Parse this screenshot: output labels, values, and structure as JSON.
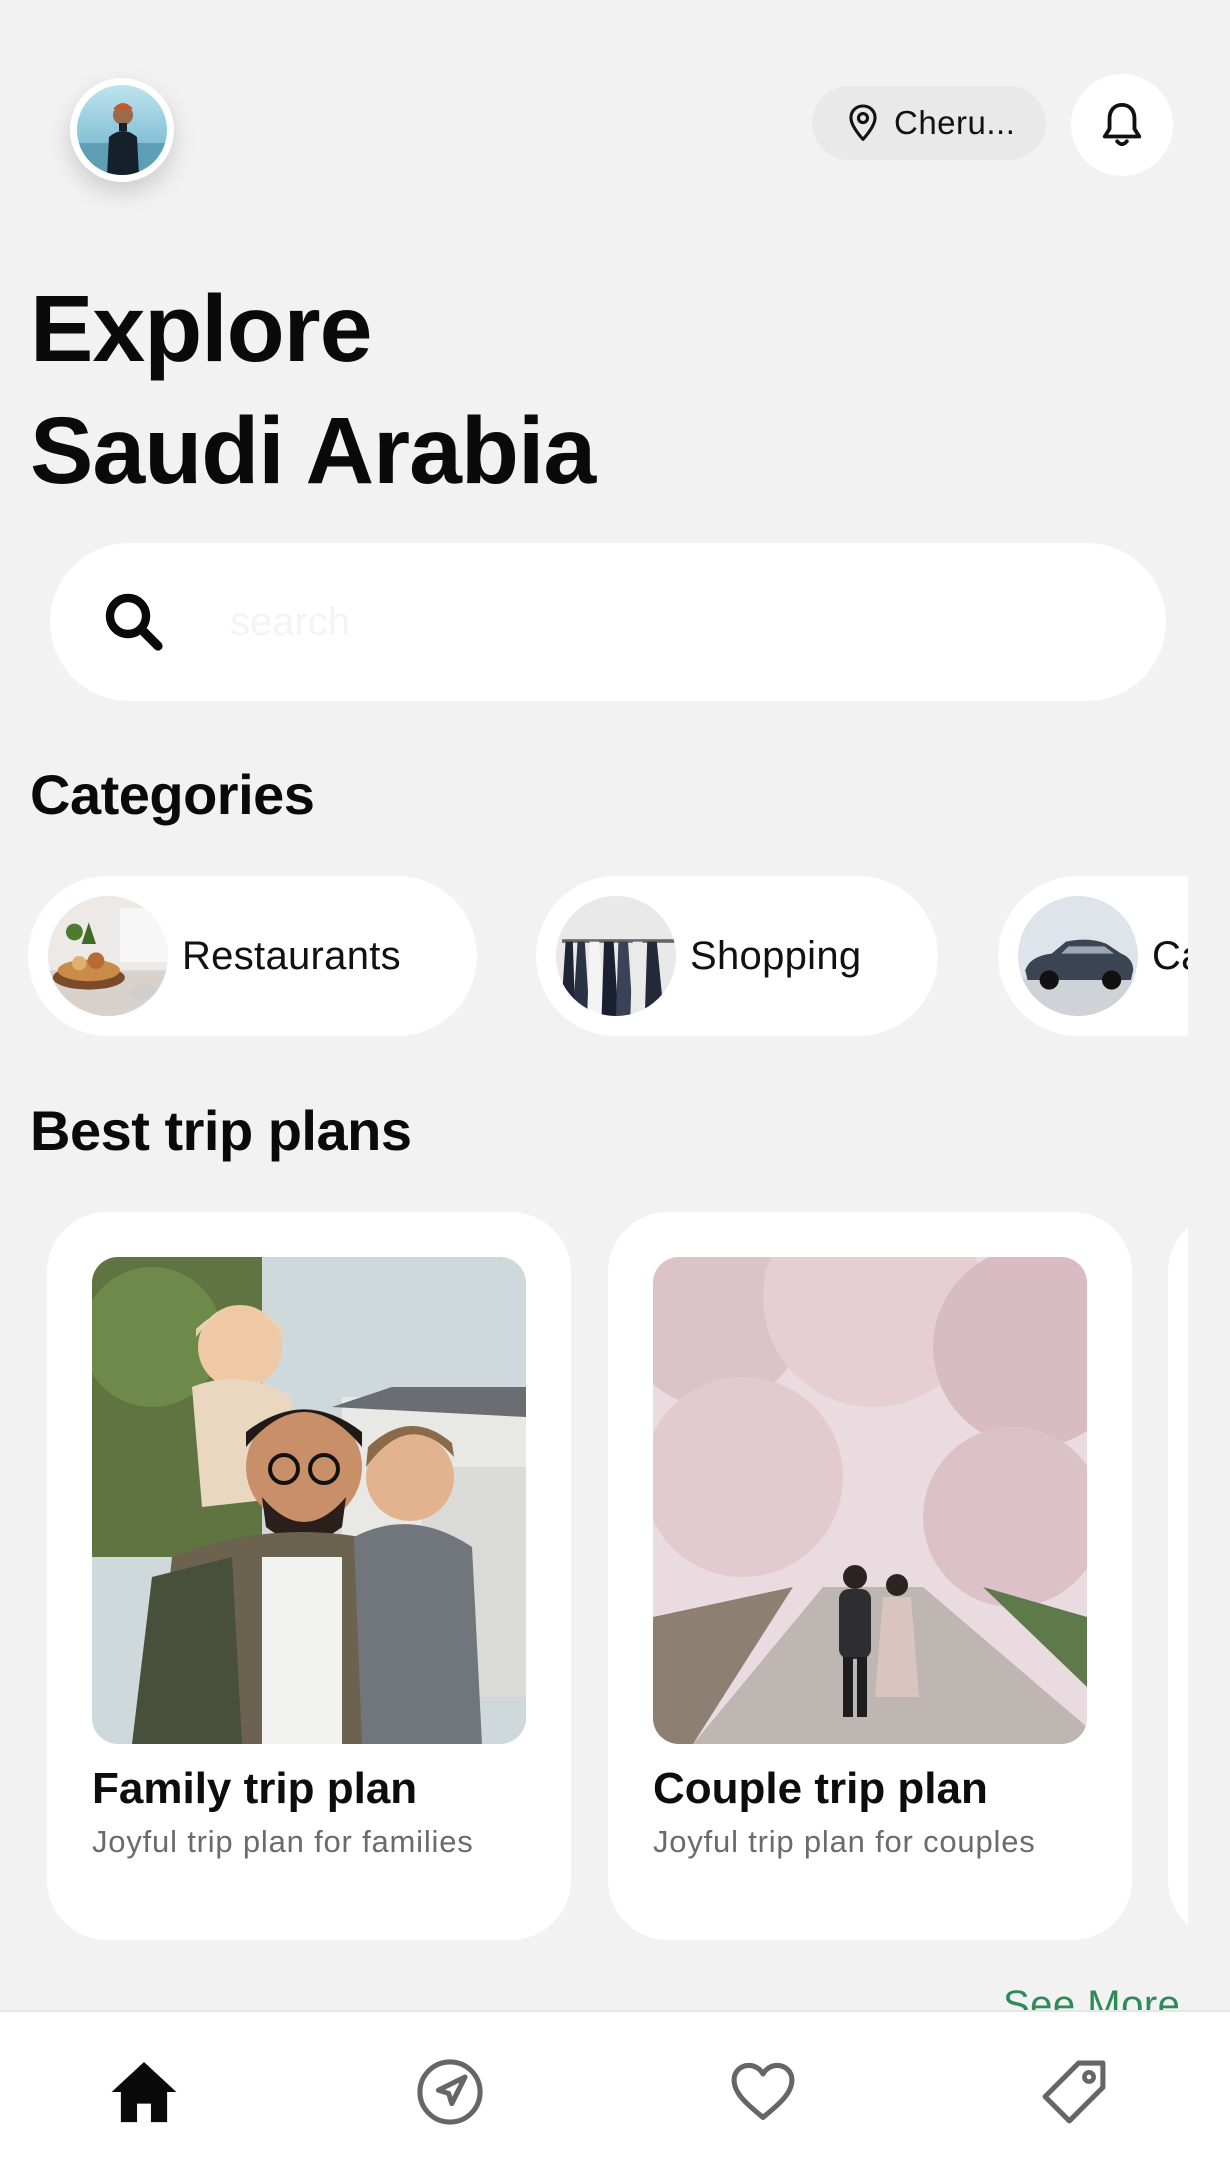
{
  "header": {
    "location_text": "Cheru...",
    "title_line1": "Explore",
    "title_line2": "Saudi Arabia"
  },
  "search": {
    "placeholder": "search"
  },
  "categories": {
    "title": "Categories",
    "items": [
      {
        "label": "Restaurants",
        "icon": "restaurant-photo"
      },
      {
        "label": "Shopping",
        "icon": "shopping-photo"
      },
      {
        "label": "Ca",
        "icon": "car-photo"
      }
    ]
  },
  "trips": {
    "title": "Best trip plans",
    "items": [
      {
        "title": "Family trip plan",
        "subtitle": "Joyful trip plan for families"
      },
      {
        "title": "Couple trip plan",
        "subtitle": "Joyful trip plan for couples"
      }
    ],
    "see_more": "See More"
  },
  "nav": {
    "items": [
      {
        "name": "home",
        "icon": "home-icon",
        "active": true
      },
      {
        "name": "explore",
        "icon": "navigation-icon",
        "active": false
      },
      {
        "name": "favorites",
        "icon": "heart-icon",
        "active": false
      },
      {
        "name": "offers",
        "icon": "tag-icon",
        "active": false
      }
    ]
  },
  "colors": {
    "background": "#f2f2f2",
    "card": "#ffffff",
    "accent_green": "#2e8a57",
    "text_primary": "#0a0a0a",
    "text_secondary": "#6b6b6b"
  }
}
